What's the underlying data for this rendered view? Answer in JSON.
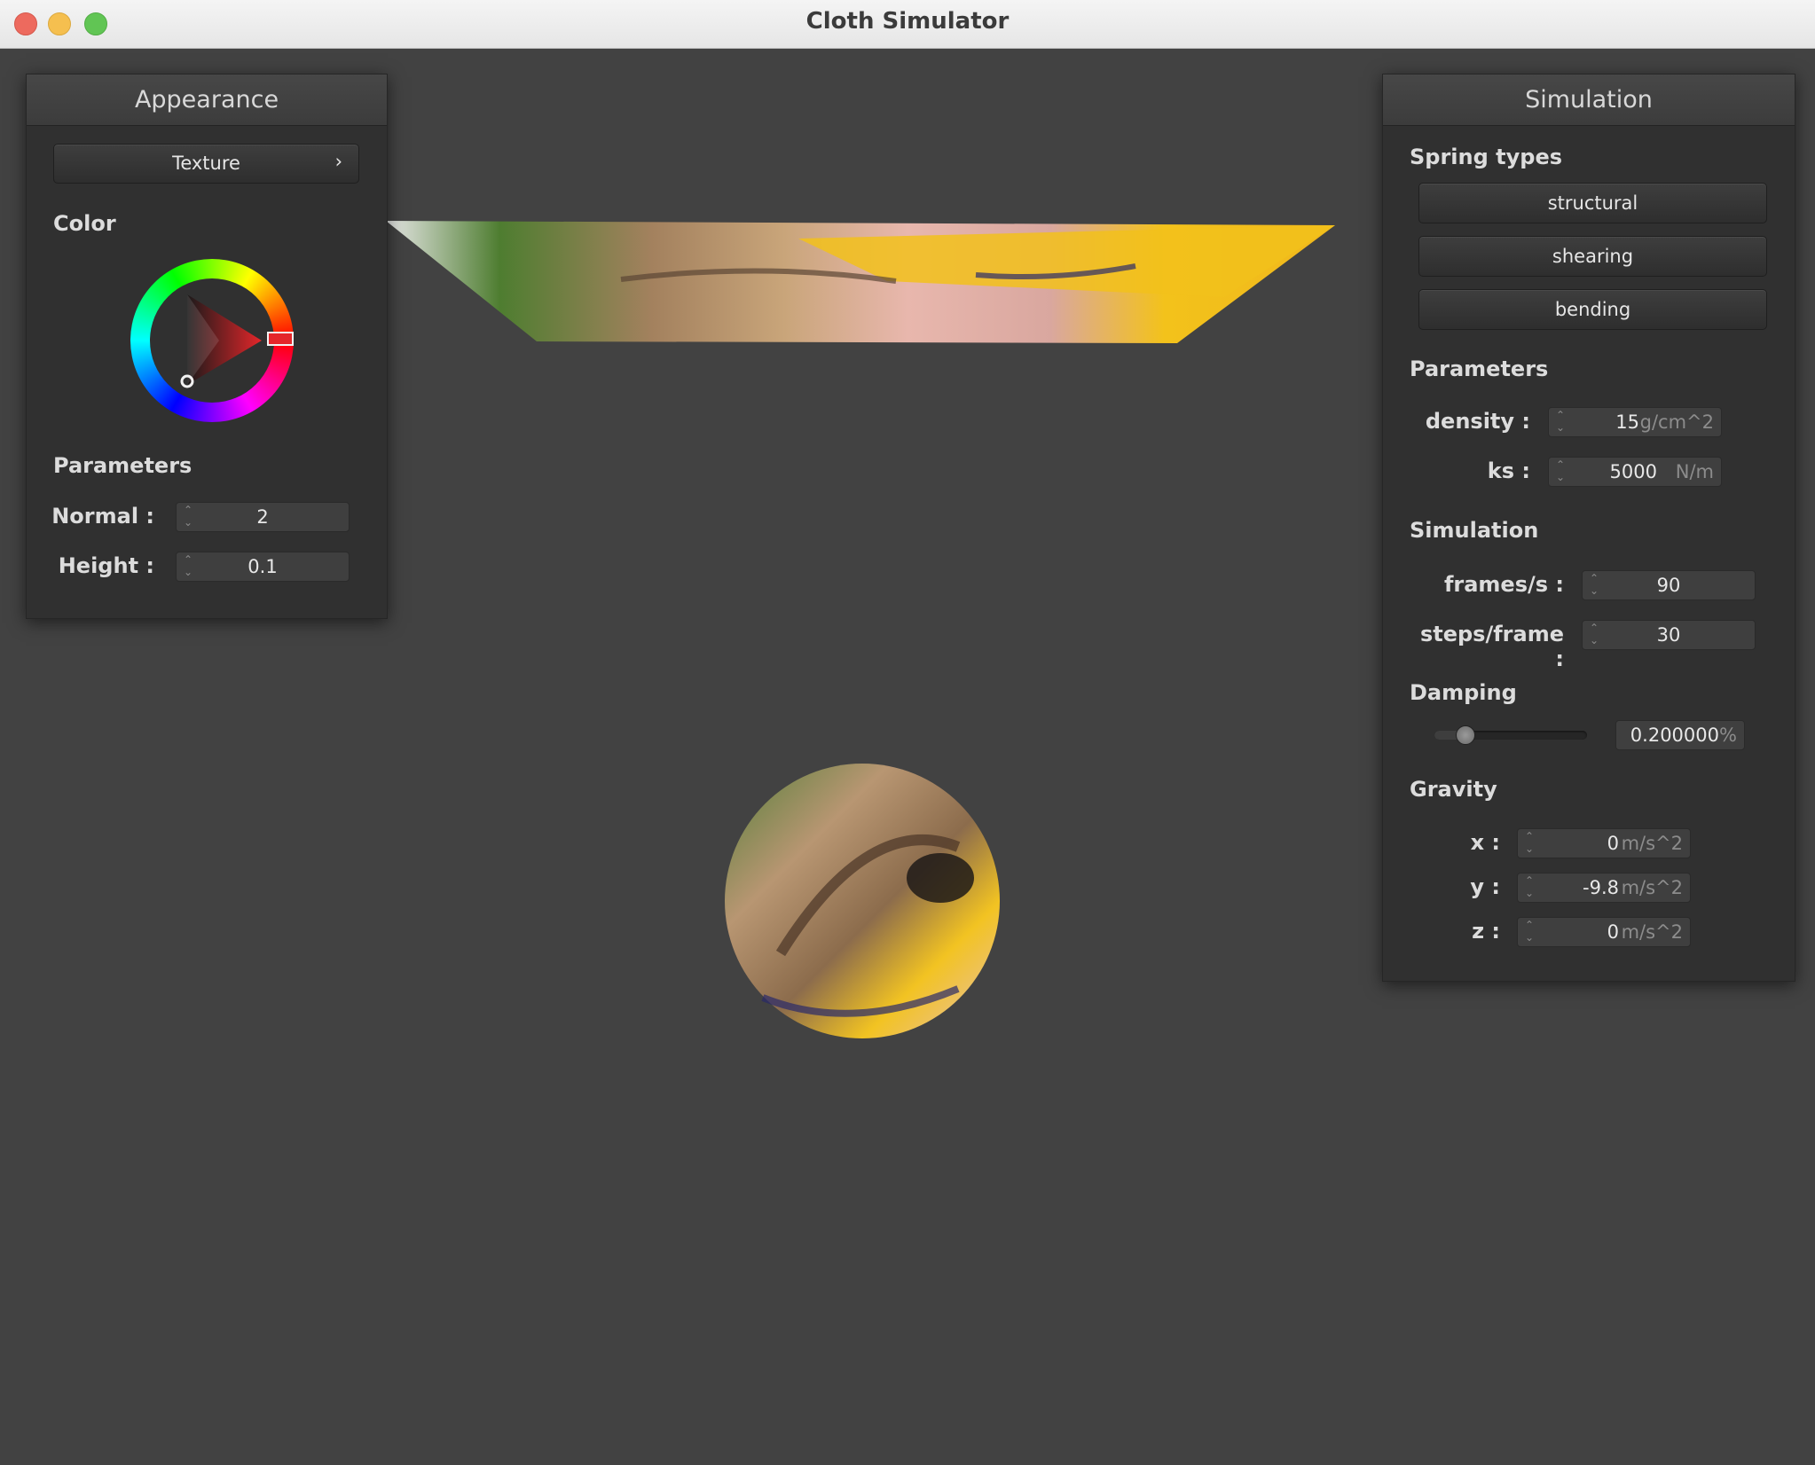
{
  "window": {
    "title": "Cloth Simulator"
  },
  "appearance": {
    "title": "Appearance",
    "texture_button": "Texture",
    "chevron": "›",
    "color_label": "Color",
    "color_selected": "#e4262a",
    "parameters_label": "Parameters",
    "normal": {
      "label": "Normal :",
      "value": "2"
    },
    "height": {
      "label": "Height :",
      "value": "0.1"
    }
  },
  "simulation": {
    "title": "Simulation",
    "spring_types_label": "Spring types",
    "springs": [
      "structural",
      "shearing",
      "bending"
    ],
    "parameters_label": "Parameters",
    "density": {
      "label": "density :",
      "value": "15",
      "unit": "g/cm^2"
    },
    "ks": {
      "label": "ks :",
      "value": "5000",
      "unit": "N/m"
    },
    "sim_label": "Simulation",
    "fps": {
      "label": "frames/s :",
      "value": "90"
    },
    "steps": {
      "label": "steps/frame :",
      "value": "30"
    },
    "damping_label": "Damping",
    "damping": {
      "value": "0.200000",
      "unit": "%",
      "slider_fraction": 0.2
    },
    "gravity_label": "Gravity",
    "gx": {
      "label": "x :",
      "value": "0",
      "unit": "m/s^2"
    },
    "gy": {
      "label": "y :",
      "value": "-9.8",
      "unit": "m/s^2"
    },
    "gz": {
      "label": "z :",
      "value": "0",
      "unit": "m/s^2"
    }
  },
  "scene": {
    "background": "#424242",
    "cloth_colors": [
      "#f2c019",
      "#e7b2a9",
      "#4d7d2f",
      "#9c7a59"
    ]
  }
}
